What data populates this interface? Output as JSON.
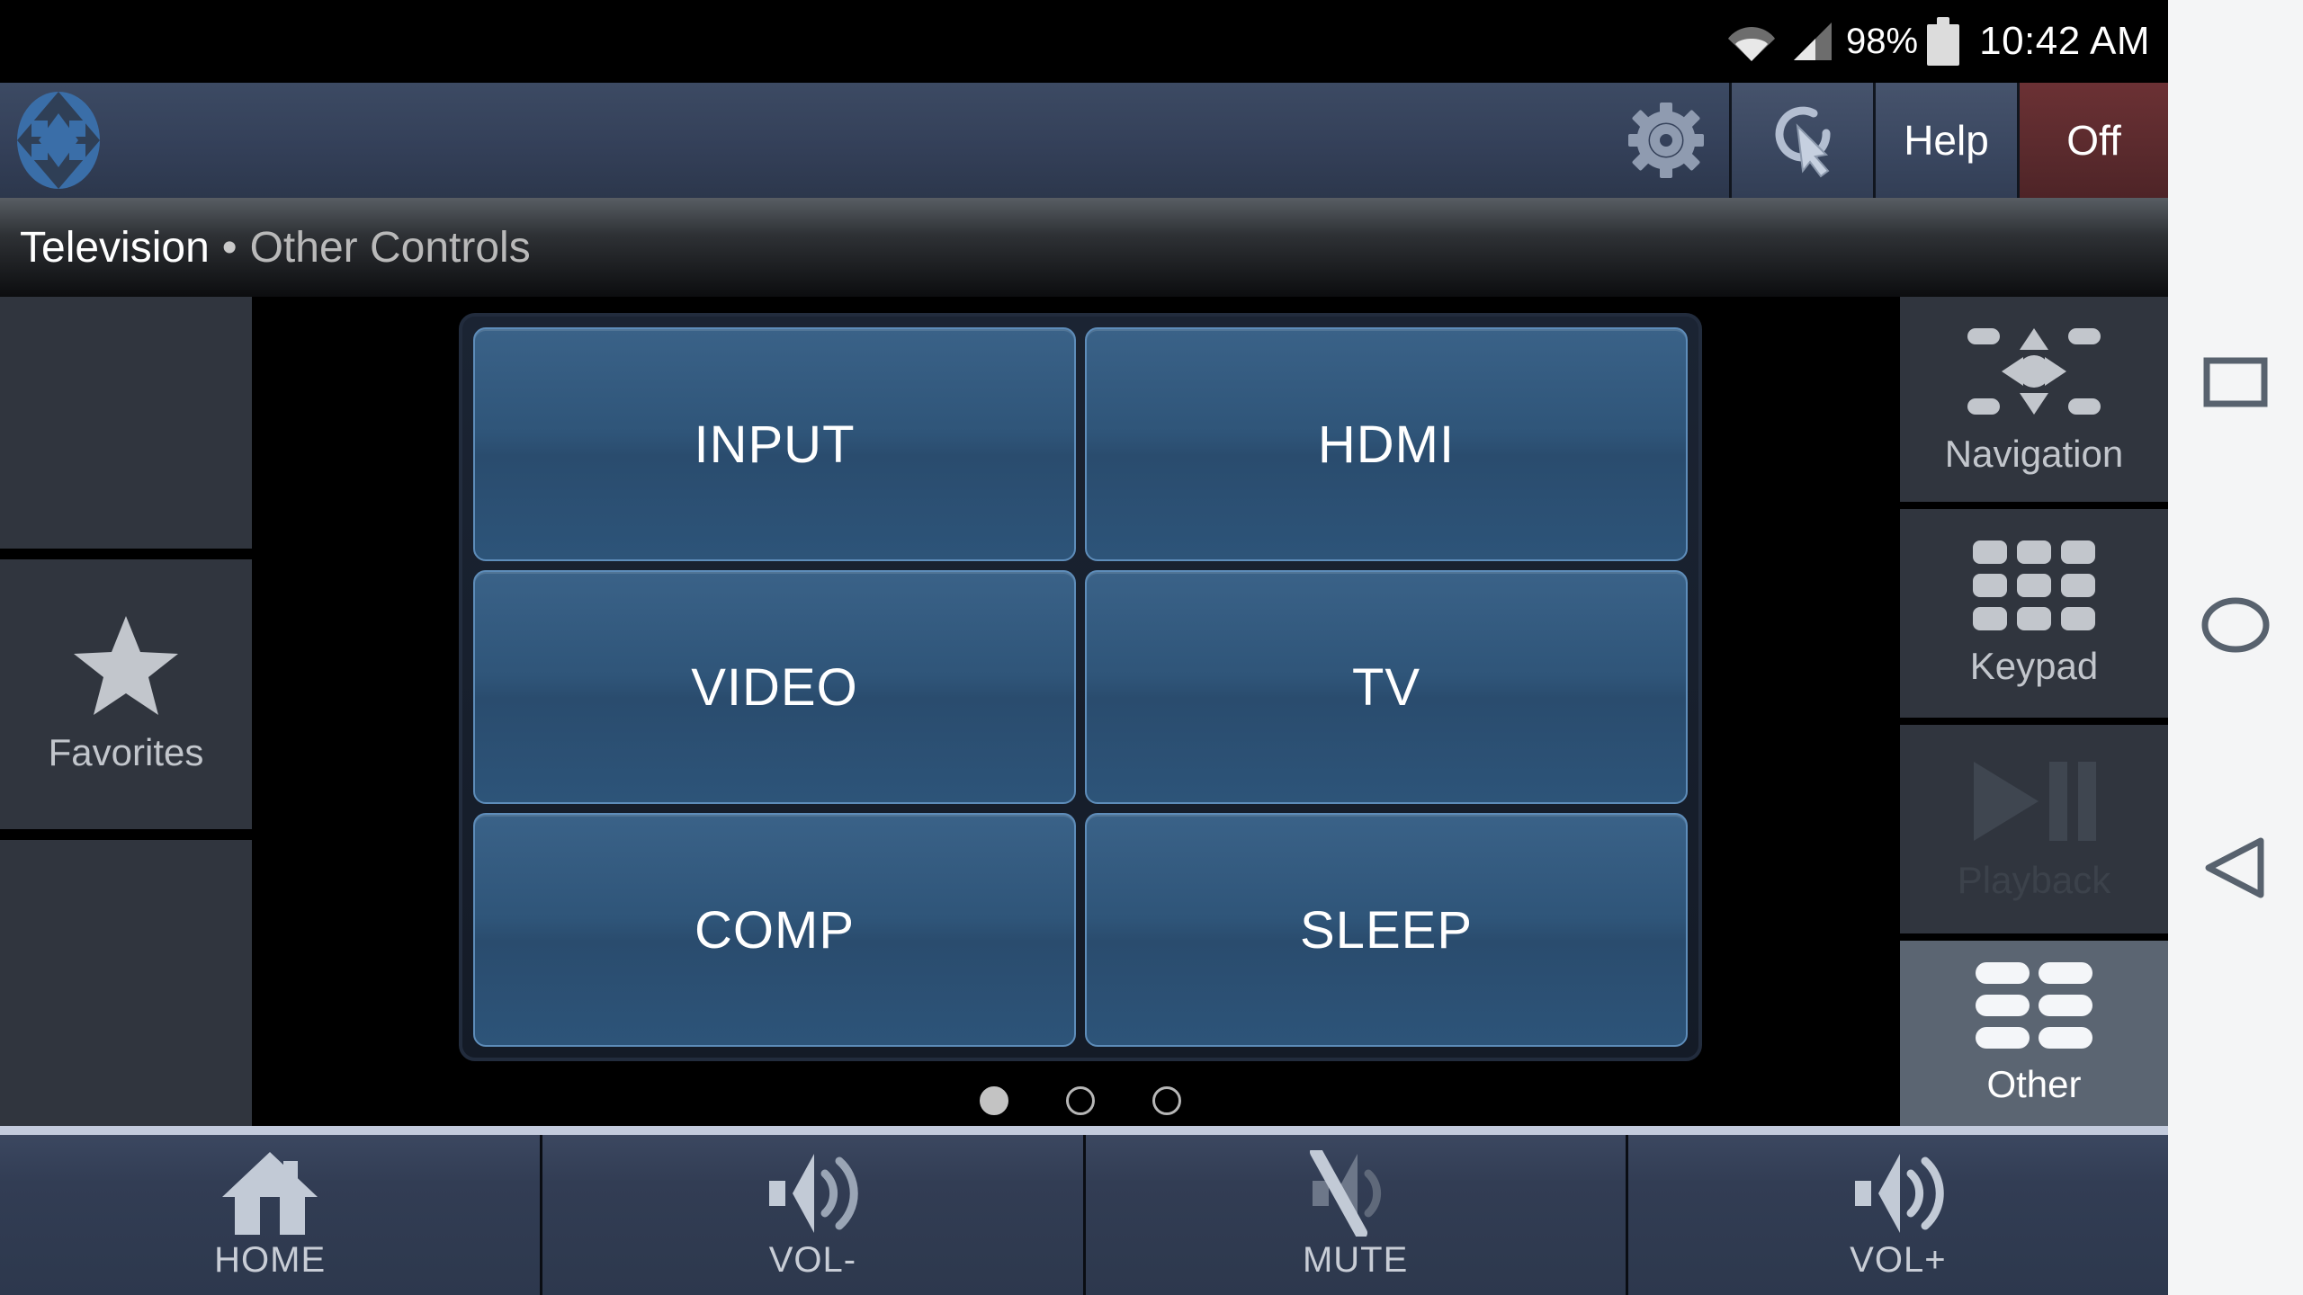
{
  "status_bar": {
    "wifi_icon": "wifi-icon",
    "signal_icon": "cellular-signal-icon",
    "battery_percent": "98%",
    "battery_icon": "battery-icon",
    "clock": "10:42 AM"
  },
  "app_bar": {
    "logo_icon": "app-logo-icon",
    "gear_icon": "gear-icon",
    "touch_icon": "touch-gesture-icon",
    "help_label": "Help",
    "off_label": "Off",
    "off_color": "#5a2a2d"
  },
  "breadcrumb": {
    "device": "Television",
    "separator": "•",
    "section": "Other Controls"
  },
  "left_rail": {
    "items": [
      {
        "label": "",
        "icon": ""
      },
      {
        "label": "Favorites",
        "icon": "star-icon"
      },
      {
        "label": "",
        "icon": ""
      }
    ]
  },
  "right_rail": {
    "items": [
      {
        "label": "Navigation",
        "icon": "dpad-icon",
        "state": "normal"
      },
      {
        "label": "Keypad",
        "icon": "keypad-grid-icon",
        "state": "normal"
      },
      {
        "label": "Playback",
        "icon": "play-pause-icon",
        "state": "disabled"
      },
      {
        "label": "Other",
        "icon": "other-grid-icon",
        "state": "active"
      }
    ]
  },
  "button_grid": {
    "buttons": [
      "INPUT",
      "HDMI",
      "VIDEO",
      "TV",
      "COMP",
      "SLEEP"
    ],
    "accent_border": "#5e8dba",
    "fill": "#2f5579"
  },
  "pagination": {
    "total": 3,
    "current": 1
  },
  "bottom_bar": {
    "buttons": [
      {
        "label": "HOME",
        "icon": "home-icon"
      },
      {
        "label": "VOL-",
        "icon": "volume-down-icon"
      },
      {
        "label": "MUTE",
        "icon": "volume-mute-icon"
      },
      {
        "label": "VOL+",
        "icon": "volume-up-icon"
      }
    ]
  },
  "android_nav": {
    "buttons": [
      {
        "name": "recents",
        "icon": "square-icon"
      },
      {
        "name": "home",
        "icon": "circle-icon"
      },
      {
        "name": "back",
        "icon": "triangle-left-icon"
      }
    ]
  }
}
